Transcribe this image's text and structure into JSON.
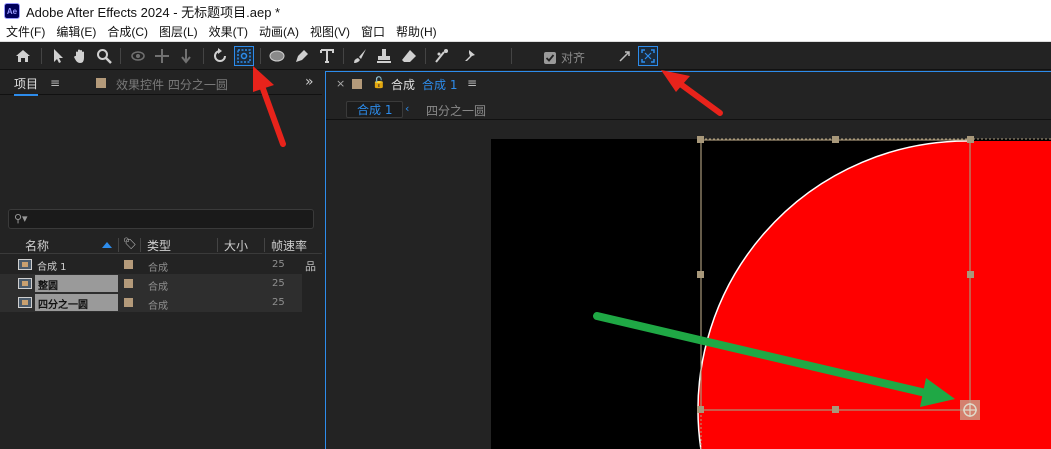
{
  "window": {
    "app_logo": "Ae",
    "title": "Adobe After Effects 2024 - 无标题项目.aep *"
  },
  "menu": [
    "文件(F)",
    "编辑(E)",
    "合成(C)",
    "图层(L)",
    "效果(T)",
    "动画(A)",
    "视图(V)",
    "窗口",
    "帮助(H)"
  ],
  "toolbar": {
    "tools": [
      "home-icon",
      "selection-arrow-icon",
      "hand-icon",
      "zoom-icon",
      "orbit-camera-icon",
      "pan-camera-icon",
      "dolly-camera-icon",
      "rotate-icon",
      "pan-behind-anchor-icon",
      "ellipse-icon",
      "pen-icon",
      "type-icon",
      "brush-icon",
      "clone-stamp-icon",
      "eraser-icon",
      "roto-brush-icon",
      "puppet-pin-icon"
    ],
    "active_tool": "pan-behind-anchor-icon",
    "snap_label": "对齐",
    "snap_checked": true
  },
  "project_panel": {
    "tab_project": "项目",
    "tab_effects": "效果控件 四分之一圆",
    "columns": {
      "name": "名称",
      "type": "类型",
      "size": "大小",
      "fps": "帧速率"
    },
    "items": [
      {
        "name": "合成 1",
        "type": "合成",
        "fps": "25",
        "highlighted": false
      },
      {
        "name": "整圆",
        "type": "合成",
        "fps": "25",
        "highlighted": true
      },
      {
        "name": "四分之一圆",
        "type": "合成",
        "fps": "25",
        "highlighted": true
      }
    ]
  },
  "comp_panel": {
    "tab_prefix": "合成",
    "tab_name": "合成 1",
    "breadcrumb_active": "合成 1",
    "breadcrumb_next": "四分之一圆"
  },
  "colors": {
    "accent": "#2d8ceb",
    "circle_fill": "#ff0000",
    "annotation_red": "#e8231b",
    "annotation_green": "#1fa845",
    "handle": "#a8987a"
  }
}
